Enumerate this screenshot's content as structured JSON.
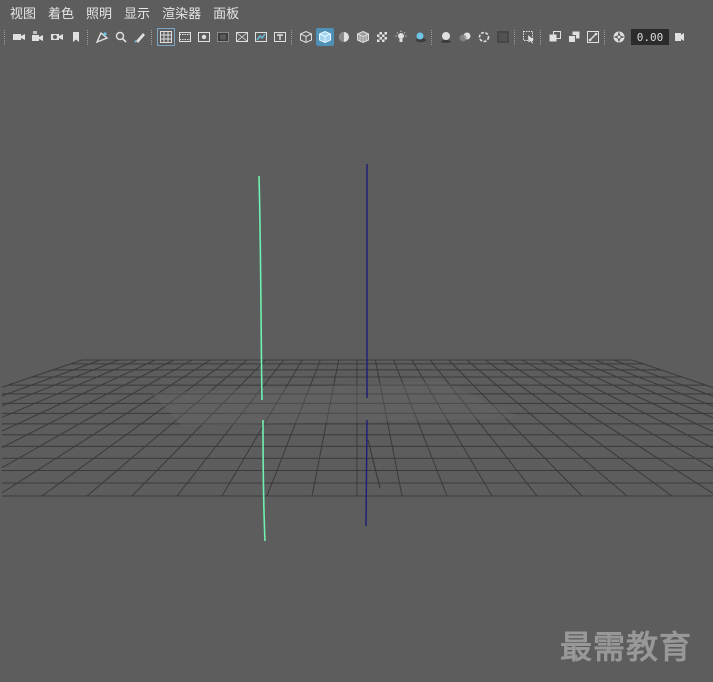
{
  "menu": {
    "items": [
      "视图",
      "着色",
      "照明",
      "显示",
      "渲染器",
      "面板"
    ]
  },
  "toolbar": {
    "exposure_value": "0.00",
    "icons": [
      "camera-icon",
      "camera-attributes-icon",
      "camera-snapshot-icon",
      "bookmark-icon",
      "image-plane-icon",
      "2d-pan-zoom-icon",
      "grease-pencil-icon",
      "grid-icon",
      "film-gate-icon",
      "resolution-gate-icon",
      "gate-mask-icon",
      "field-chart-icon",
      "safe-action-icon",
      "safe-title-icon",
      "wireframe-icon",
      "smooth-shade-icon",
      "use-default-material-icon",
      "wireframe-on-shaded-icon",
      "textured-icon",
      "use-all-lights-icon",
      "shadows-icon",
      "screen-space-ao-icon",
      "motion-blur-icon",
      "multisample-aa-icon",
      "depth-of-field-icon",
      "isolate-select-icon",
      "xray-icon",
      "xray-active-components-icon",
      "xray-joints-icon",
      "exposure-icon",
      "gamma-icon"
    ]
  },
  "colors": {
    "background": "#5d5d5d",
    "grid": "#3a3a3a",
    "curve_a": "#6ff0b0",
    "curve_b": "#1d1d78",
    "active_button": "#4f90b6"
  },
  "watermark": "最需教育"
}
